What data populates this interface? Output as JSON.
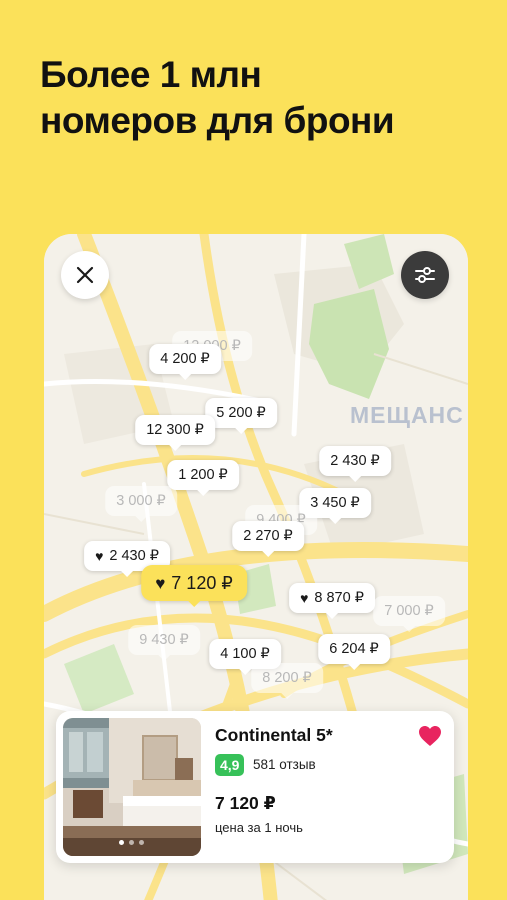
{
  "headline": {
    "line1": "Более 1 млн",
    "line2": "номеров для брони"
  },
  "map": {
    "district_label": "МЕЩАНС",
    "close_icon": "close-icon",
    "filter_icon": "sliders-icon",
    "pins": [
      {
        "label": "12 000 ₽",
        "faded": true,
        "favorite": false,
        "selected": false
      },
      {
        "label": "4 200 ₽",
        "faded": false,
        "favorite": false,
        "selected": false
      },
      {
        "label": "5 200 ₽",
        "faded": false,
        "favorite": false,
        "selected": false
      },
      {
        "label": "12 300 ₽",
        "faded": false,
        "favorite": false,
        "selected": false
      },
      {
        "label": "1 200 ₽",
        "faded": false,
        "favorite": false,
        "selected": false
      },
      {
        "label": "2 430 ₽",
        "faded": false,
        "favorite": false,
        "selected": false
      },
      {
        "label": "3 000 ₽",
        "faded": true,
        "favorite": false,
        "selected": false
      },
      {
        "label": "3 450 ₽",
        "faded": false,
        "favorite": false,
        "selected": false
      },
      {
        "label": "9 400 ₽",
        "faded": true,
        "favorite": false,
        "selected": false
      },
      {
        "label": "2 270 ₽",
        "faded": false,
        "favorite": false,
        "selected": false
      },
      {
        "label": "2 430 ₽",
        "faded": false,
        "favorite": true,
        "selected": false
      },
      {
        "label": "7 120 ₽",
        "faded": false,
        "favorite": true,
        "selected": true
      },
      {
        "label": "8 870 ₽",
        "faded": false,
        "favorite": true,
        "selected": false
      },
      {
        "label": "7 000 ₽",
        "faded": true,
        "favorite": false,
        "selected": false
      },
      {
        "label": "9 430 ₽",
        "faded": true,
        "favorite": false,
        "selected": false
      },
      {
        "label": "4 100 ₽",
        "faded": false,
        "favorite": false,
        "selected": false
      },
      {
        "label": "6 204 ₽",
        "faded": false,
        "favorite": false,
        "selected": false
      },
      {
        "label": "8 200 ₽",
        "faded": true,
        "favorite": false,
        "selected": false
      }
    ]
  },
  "hotel_card": {
    "name": "Continental 5*",
    "rating": "4,9",
    "reviews": "581 отзыв",
    "price": "7 120 ₽",
    "price_note": "цена за 1 ночь",
    "favorite": true,
    "photo_count": 3,
    "photo_index": 0
  },
  "colors": {
    "background": "#fbe15a",
    "selected_pin": "#fbe15a",
    "rating_badge": "#37c159",
    "favorite_heart": "#e8245f",
    "filter_button": "#3b3b3b"
  }
}
